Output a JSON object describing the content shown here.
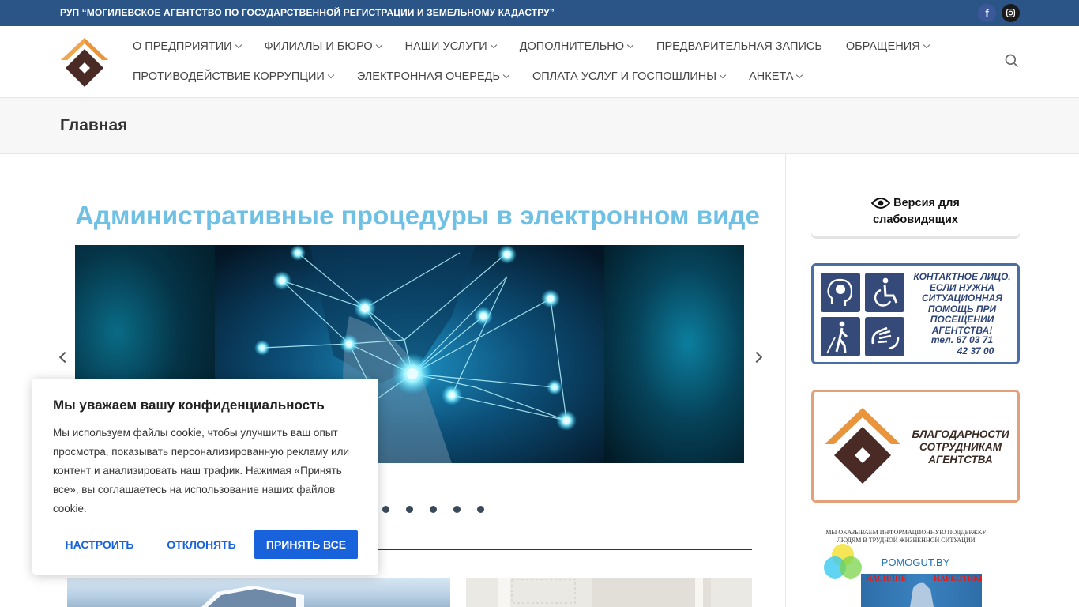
{
  "topbar": {
    "title": "РУП “МОГИЛЕВСКОЕ АГЕНТСТВО ПО ГОСУДАРСТВЕННОЙ РЕГИСТРАЦИИ И ЗЕМЕЛЬНОМУ КАДАСТРУ”",
    "facebook_glyph": "f",
    "instagram_icon": "instagram-icon"
  },
  "nav": {
    "row1": [
      {
        "label": "О ПРЕДПРИЯТИИ",
        "has_dropdown": true
      },
      {
        "label": "ФИЛИАЛЫ И БЮРО",
        "has_dropdown": true
      },
      {
        "label": "НАШИ УСЛУГИ",
        "has_dropdown": true
      },
      {
        "label": "ДОПОЛНИТЕЛЬНО",
        "has_dropdown": true
      },
      {
        "label": "ПРЕДВАРИТЕЛЬНАЯ ЗАПИСЬ",
        "has_dropdown": false
      },
      {
        "label": "ОБРАЩЕНИЯ",
        "has_dropdown": true
      }
    ],
    "row2": [
      {
        "label": "ПРОТИВОДЕЙСТВИЕ КОРРУПЦИИ",
        "has_dropdown": true
      },
      {
        "label": "ЭЛЕКТРОННАЯ ОЧЕРЕДЬ",
        "has_dropdown": true
      },
      {
        "label": "ОПЛАТА УСЛУГ И ГОСПОШЛИНЫ",
        "has_dropdown": true
      },
      {
        "label": "АНКЕТА",
        "has_dropdown": true
      }
    ]
  },
  "page": {
    "title": "Главная",
    "headline": "Административные процедуры в электронном виде"
  },
  "slider": {
    "dot_count": 5
  },
  "sidebar": {
    "visually_impaired_line1": "Версия для",
    "visually_impaired_line2": "слабовидящих",
    "contact_text": "КОНТАКТНОЕ ЛИЦО, ЕСЛИ НУЖНА СИТУАЦИОННАЯ ПОМОЩЬ ПРИ ПОСЕЩЕНИИ АГЕНТСТВА!",
    "contact_phone1": "тел. 67 03 71",
    "contact_phone2": "42 37 00",
    "thanks_text": "БЛАГОДАРНОСТИ СОТРУДНИКАМ АГЕНТСТВА",
    "pomogut_small": "МЫ ОКАЗЫВАЕМ ИНФОРМАЦИОННУЮ ПОДДЕРЖКУ ЛЮДЯМ В ТРУДНОЙ ЖИЗНЕННОЙ СИТУАЦИИ",
    "pomogut_name": "POMOGUT.BY",
    "pomogut_strip_left": "НАСИЛИЕ",
    "pomogut_strip_right": "НАРКОТИКИ"
  },
  "cookie": {
    "title": "Мы уважаем вашу конфиденциальность",
    "text": "Мы используем файлы cookie, чтобы улучшить ваш опыт просмотра, показывать персонализированную рекламу или контент и анализировать наш трафик. Нажимая «Принять все», вы соглашаетесь на использование наших файлов cookie.",
    "configure_label": "НАСТРОИТЬ",
    "reject_label": "ОТКЛОНЯТЬ",
    "accept_label": "ПРИНЯТЬ ВСЕ"
  },
  "colors": {
    "topbar": "#2b5586",
    "headline": "#6ec1e4",
    "logo_orange": "#e8953e",
    "logo_brown": "#4a2a24",
    "cookie_button": "#1863dc"
  }
}
